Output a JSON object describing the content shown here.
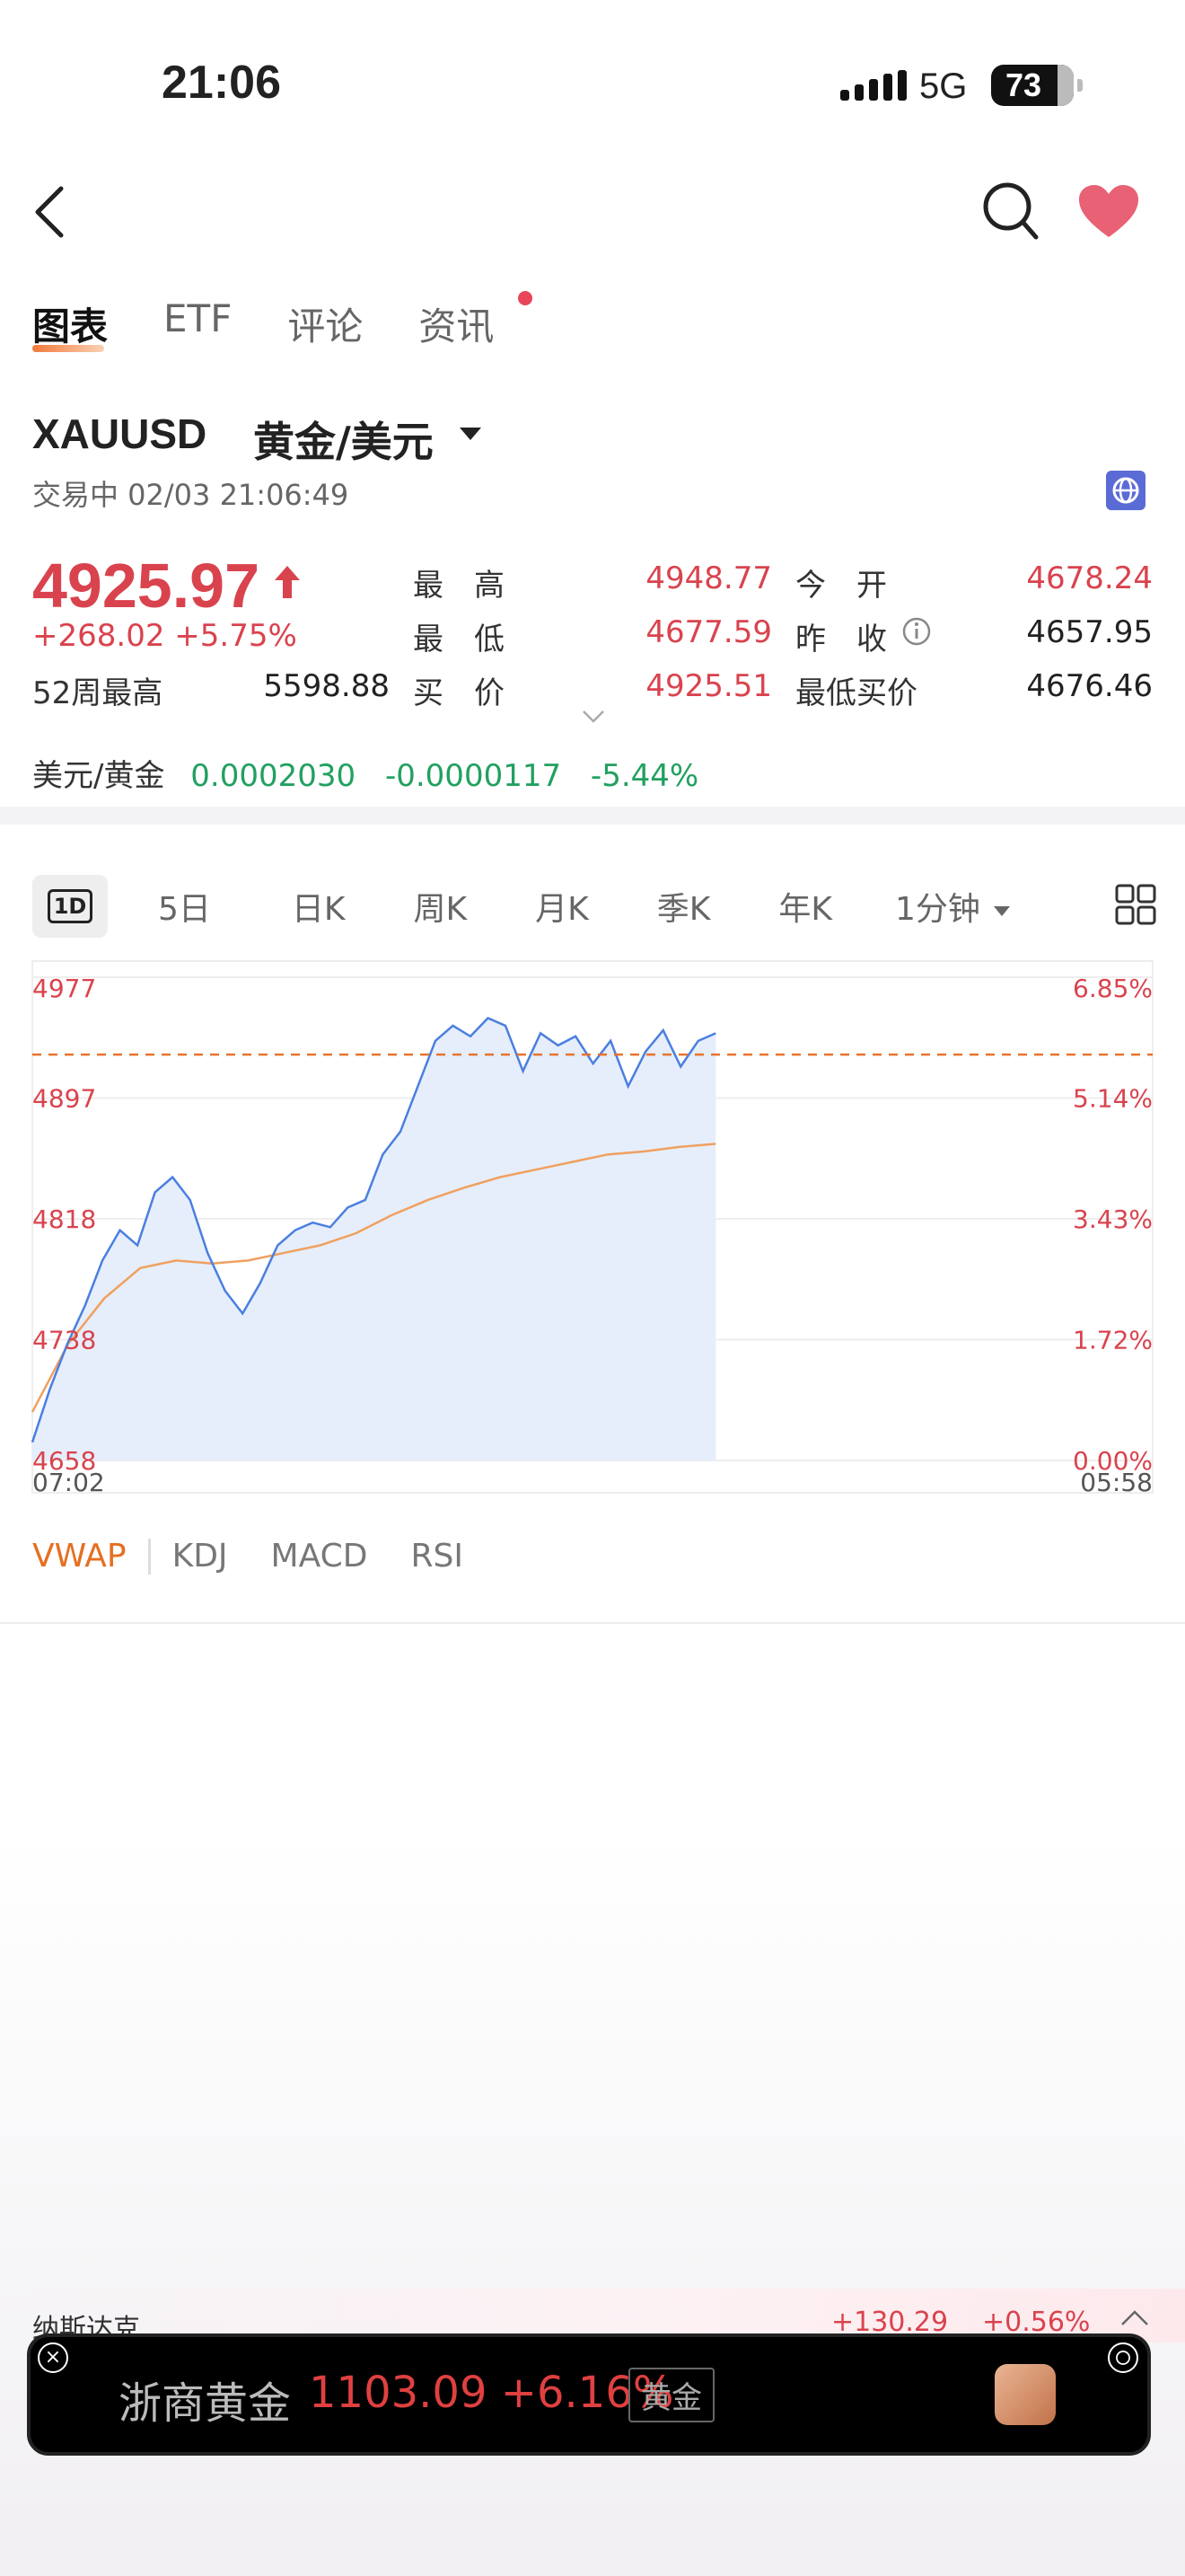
{
  "status_bar": {
    "time": "21:06",
    "network": "5G",
    "battery": "73"
  },
  "tabs": [
    "图表",
    "ETF",
    "评论",
    "资讯"
  ],
  "symbol": {
    "code": "XAUUSD",
    "name": "黄金/美元",
    "status": "交易中 02/03 21:06:49"
  },
  "price": {
    "last": "4925.97",
    "change": "+268.02",
    "change_pct": "+5.75%"
  },
  "quote": {
    "high_label": "最　高",
    "high": "4948.77",
    "low_label": "最　低",
    "low": "4677.59",
    "bid_label": "买　价",
    "bid": "4925.51",
    "open_label": "今　开",
    "open": "4678.24",
    "prev_label": "昨　收",
    "prev": "4657.95",
    "minbid_label": "最低买价",
    "minbid": "4676.46",
    "week52_label": "52周最高",
    "week52": "5598.88"
  },
  "fx": {
    "label": "美元/黄金",
    "value": "0.0002030",
    "change": "-0.0000117",
    "pct": "-5.44%"
  },
  "periods": {
    "oneday_badge": "1D",
    "items": [
      "5日",
      "日K",
      "周K",
      "月K",
      "季K",
      "年K"
    ],
    "interval": "1分钟"
  },
  "chart_data": {
    "type": "area",
    "y_ticks_left": [
      "4977",
      "4897",
      "4818",
      "4738",
      "4658"
    ],
    "y_ticks_right": [
      "6.85%",
      "5.14%",
      "3.43%",
      "1.72%",
      "0.00%"
    ],
    "x_ticks": [
      "07:02",
      "05:58"
    ],
    "ylim": [
      4658,
      4977
    ],
    "reference_line": 4925.97,
    "series": [
      {
        "name": "",
        "values": [
          4670,
          4705,
          4735,
          4760,
          4790,
          4810,
          4800,
          4835,
          4845,
          4830,
          4795,
          4770,
          4755,
          4775,
          4800,
          4810,
          4815,
          4812,
          4825,
          4830,
          4860,
          4875,
          4905,
          4935,
          4945,
          4938,
          4950,
          4945,
          4915,
          4940,
          4932,
          4938,
          4920,
          4935,
          4905,
          4928,
          4942,
          4918,
          4935,
          4940
        ]
      },
      {
        "name": "",
        "values": [
          4690,
          4735,
          4765,
          4785,
          4790,
          4788,
          4790,
          4795,
          4800,
          4808,
          4820,
          4830,
          4838,
          4845,
          4850,
          4855,
          4860,
          4862,
          4865,
          4867
        ]
      }
    ]
  },
  "indicators": [
    "VWAP",
    "KDJ",
    "MACD",
    "RSI"
  ],
  "ticker": {
    "name": "纳斯达克",
    "change": "+130.29",
    "pct": "+0.56%"
  },
  "ad": {
    "name": "浙商黄金",
    "price": "1103.09",
    "pct": "+6.16%",
    "tag": "黄金"
  }
}
